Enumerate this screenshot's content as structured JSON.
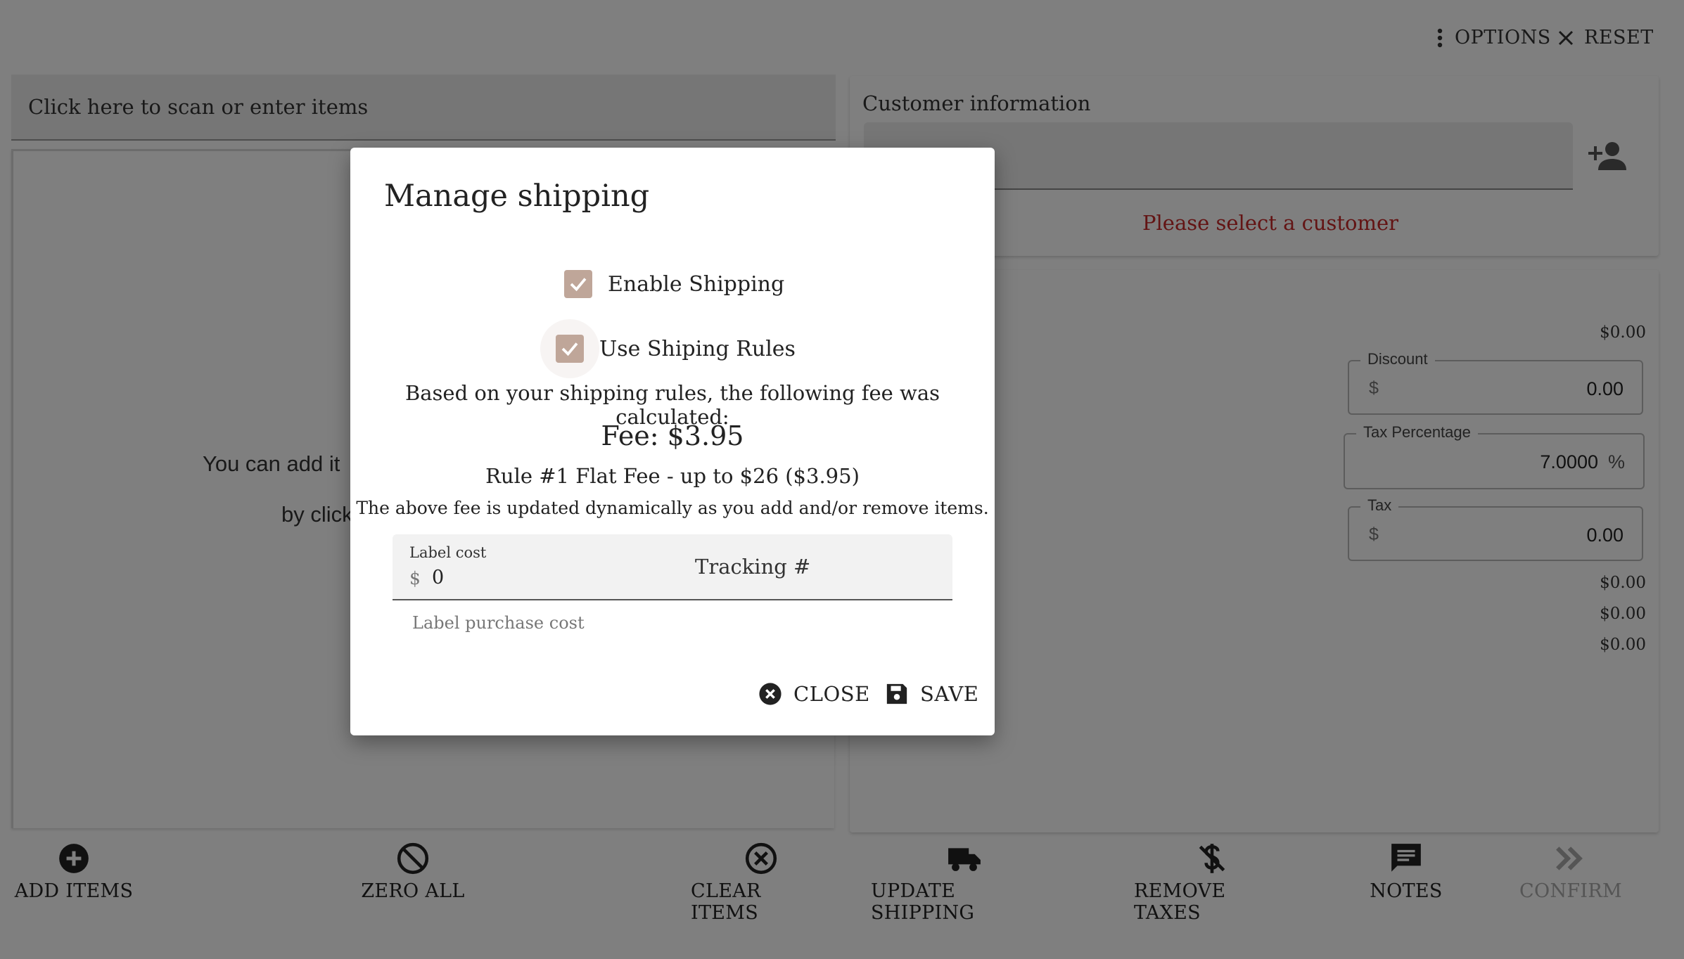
{
  "topbar": {
    "options_label": "OPTIONS",
    "reset_label": "RESET"
  },
  "scan": {
    "placeholder": "Click here to scan or enter items"
  },
  "items_panel": {
    "empty_line1": "You can add it",
    "empty_line2": "by click"
  },
  "customer": {
    "title": "Customer information",
    "warning": "Please select a customer"
  },
  "totals": {
    "subtotal": "$0.00",
    "discount": {
      "legend": "Discount",
      "prefix": "$",
      "value": "0.00"
    },
    "tax_percentage": {
      "legend": "Tax Percentage",
      "value": "7.0000",
      "suffix": "%"
    },
    "tax": {
      "legend": "Tax",
      "prefix": "$",
      "value": "0.00"
    },
    "line1": "$0.00",
    "line2": "$0.00",
    "line3": "$0.00"
  },
  "bottom_actions": [
    {
      "label": "ADD ITEMS",
      "icon": "add-circle-icon"
    },
    {
      "label": "ZERO ALL",
      "icon": "block-icon"
    },
    {
      "label": "CLEAR ITEMS",
      "icon": "cancel-circle-icon"
    },
    {
      "label": "UPDATE SHIPPING",
      "icon": "truck-icon"
    },
    {
      "label": "REMOVE TAXES",
      "icon": "money-off-icon"
    },
    {
      "label": "NOTES",
      "icon": "comment-icon"
    },
    {
      "label": "CONFIRM",
      "icon": "double-chevron-icon",
      "disabled": true
    }
  ],
  "dialog": {
    "title": "Manage shipping",
    "enable_shipping": {
      "label": "Enable Shipping",
      "checked": true
    },
    "use_rules": {
      "label": "Use Shiping Rules",
      "checked": true
    },
    "rules_intro": "Based on your shipping rules, the following fee was calculated:",
    "fee": "Fee: $3.95",
    "rule": "Rule #1 Flat Fee - up to $26 ($3.95)",
    "dynamic_note": "The above fee is updated dynamically as you add and/or remove items.",
    "label_cost": {
      "label": "Label cost",
      "prefix": "$",
      "value": "0",
      "helper": "Label purchase cost"
    },
    "tracking": {
      "placeholder": "Tracking #"
    },
    "close_label": "CLOSE",
    "save_label": "SAVE"
  },
  "colors": {
    "checkbox": "#bfa699",
    "warning": "#c62828"
  }
}
